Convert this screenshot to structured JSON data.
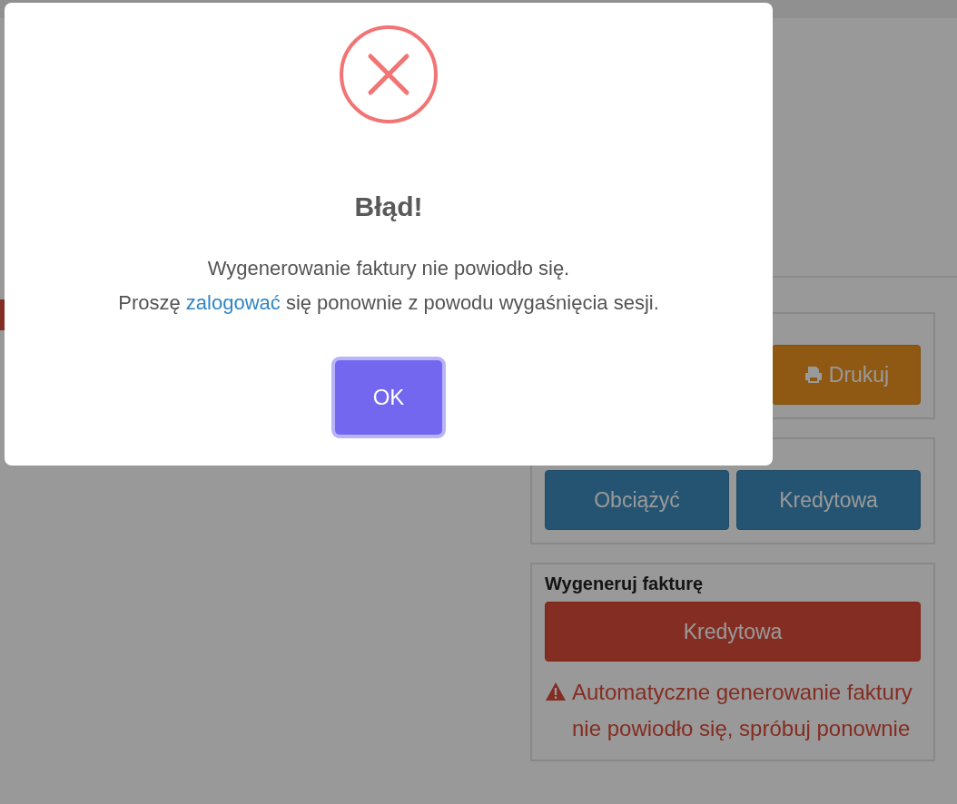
{
  "page": {
    "print_panel": {
      "button": "Drukuj"
    },
    "correction_panel": {
      "buttons": [
        "Obciążyć",
        "Kredytowa"
      ]
    },
    "invoice_panel": {
      "title": "Wygeneruj fakturę",
      "button": "Kredytowa",
      "warning": "Automatyczne generowanie faktury nie powiodło się, spróbuj ponownie"
    }
  },
  "dialog": {
    "kind": "error",
    "title": "Błąd!",
    "message": "Wygenerowanie faktury nie powiodło się.",
    "message_2": {
      "before": "Proszę ",
      "link": "zalogować",
      "after": " się ponownie z powodu wygaśnięcia sesji."
    },
    "button": "OK"
  }
}
